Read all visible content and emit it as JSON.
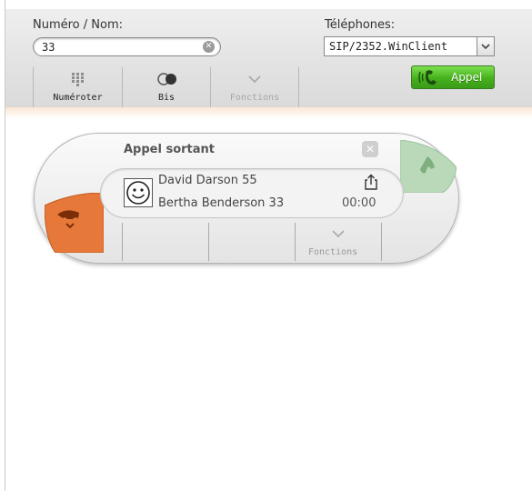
{
  "form": {
    "number_label": "Numéro / Nom:",
    "number_value": "33",
    "phones_label": "Téléphones:",
    "phone_selected": "SIP/2352.WinClient"
  },
  "toolbar": {
    "dial_label": "Numéroter",
    "redial_label": "Bis",
    "functions_label": "Fonctions",
    "call_label": "Appel"
  },
  "call": {
    "title": "Appel sortant",
    "caller": "David Darson 55",
    "callee": "Bertha Benderson 33",
    "duration": "00:00",
    "functions_label": "Fonctions"
  },
  "colors": {
    "call_button_green": "#45b01c",
    "hangup_orange": "#e6793a",
    "accept_green_disabled": "#b9d9b9"
  },
  "icons": {
    "dial": "keypad-icon",
    "redial": "redial-icon",
    "functions": "chevron-down-icon",
    "call": "phone-icon",
    "hangup": "hangup-icon",
    "accept": "accept-call-icon",
    "close": "close-icon",
    "avatar": "smiley-icon",
    "transfer": "share-icon"
  }
}
